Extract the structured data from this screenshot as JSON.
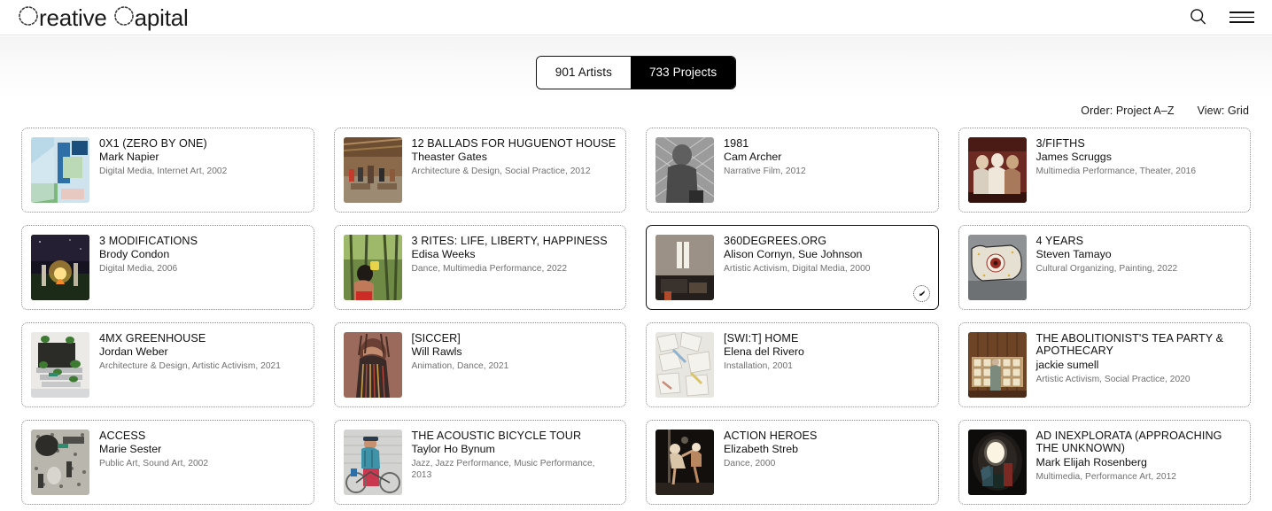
{
  "header": {
    "logo_text": "Creative Capital",
    "logo_word_1": "reative",
    "logo_word_2": "apital",
    "search_icon": "search-icon",
    "menu_icon": "hamburger-menu-icon"
  },
  "toggle": {
    "artists_label": "901 Artists",
    "projects_label": "733 Projects",
    "active": "projects"
  },
  "controls": {
    "order_label": "Order: Project A–Z",
    "view_label": "View: Grid"
  },
  "colors": {
    "accent": "#000000",
    "border_dotted": "#8d8d8d",
    "meta_text": "#6f6f6f"
  },
  "cards": [
    {
      "title": "0X1 (ZERO BY ONE)",
      "artist": "Mark Napier",
      "meta": "Digital Media, Internet Art, 2002",
      "hovered": false,
      "thumb": "digital-collage-blue-green"
    },
    {
      "title": "12 BALLADS FOR HUGUENOT HOUSE",
      "artist": "Theaster Gates",
      "meta": "Architecture & Design, Social Practice, 2012",
      "hovered": false,
      "thumb": "warehouse-interior-people"
    },
    {
      "title": "1981",
      "artist": "Cam Archer",
      "meta": "Narrative Film, 2012",
      "hovered": false,
      "thumb": "bw-fence-figure"
    },
    {
      "title": "3/FIFTHS",
      "artist": "James Scruggs",
      "meta": "Multimedia Performance, Theater, 2016",
      "hovered": false,
      "thumb": "dark-red-performers"
    },
    {
      "title": "3 MODIFICATIONS",
      "artist": "Brody Condon",
      "meta": "Digital Media, 2006",
      "hovered": false,
      "thumb": "night-bonfire-figures"
    },
    {
      "title": "3 RITES: LIFE, LIBERTY, HAPPINESS",
      "artist": "Edisa Weeks",
      "meta": "Dance, Multimedia Performance, 2022",
      "hovered": false,
      "thumb": "forest-dancer-yellow"
    },
    {
      "title": "360DEGREES.ORG",
      "artist": "Alison Cornyn, Sue Johnson",
      "meta": "Artistic Activism, Digital Media, 2000",
      "hovered": true,
      "thumb": "prison-cell-window"
    },
    {
      "title": "4 YEARS",
      "artist": "Steven Tamayo",
      "meta": "Cultural Organizing, Painting, 2022",
      "hovered": false,
      "thumb": "hide-painting-circle"
    },
    {
      "title": "4MX GREENHOUSE",
      "artist": "Jordan Weber",
      "meta": "Architecture & Design, Artistic Activism, 2021",
      "hovered": false,
      "thumb": "greenhouse-plants-white"
    },
    {
      "title": "[SICCER]",
      "artist": "Will Rawls",
      "meta": "Animation, Dance, 2021",
      "hovered": false,
      "thumb": "portrait-braids-hand"
    },
    {
      "title": "[SWI:T] HOME",
      "artist": "Elena del Rivero",
      "meta": "Installation, 2001",
      "hovered": false,
      "thumb": "paper-scraps-installation"
    },
    {
      "title": "THE ABOLITIONIST'S TEA PARTY & APOTHECARY",
      "artist": "jackie sumell",
      "meta": "Artistic Activism, Social Practice, 2020",
      "hovered": false,
      "thumb": "apothecary-shelves-figure"
    },
    {
      "title": "ACCESS",
      "artist": "Marie Sester",
      "meta": "Public Art, Sound Art, 2002",
      "hovered": false,
      "thumb": "aerial-plaza-dots"
    },
    {
      "title": "THE ACOUSTIC BICYCLE TOUR",
      "artist": "Taylor Ho Bynum",
      "meta": "Jazz, Jazz Performance, Music Performance, 2013",
      "hovered": false,
      "thumb": "cyclist-red-pants"
    },
    {
      "title": "ACTION HEROES",
      "artist": "Elizabeth Streb",
      "meta": "Dance, 2000",
      "hovered": false,
      "thumb": "stage-aerial-performers"
    },
    {
      "title": "AD INEXPLORATA (APPROACHING THE UNKNOWN)",
      "artist": "Mark Elijah Rosenberg",
      "meta": "Multimedia, Performance Art, 2012",
      "hovered": false,
      "thumb": "dark-portal-light"
    }
  ]
}
